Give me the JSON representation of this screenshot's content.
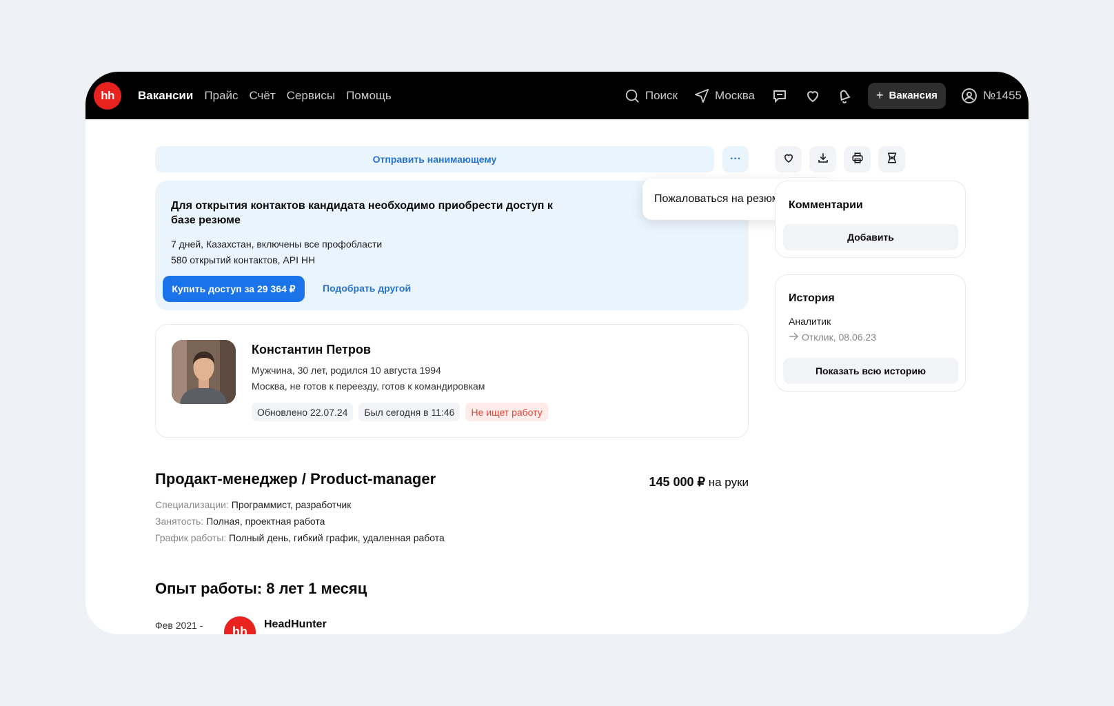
{
  "navbar": {
    "logo": "hh",
    "links": [
      "Вакансии",
      "Прайс",
      "Счёт",
      "Сервисы",
      "Помощь"
    ],
    "search_label": "Поиск",
    "city_label": "Москва",
    "vacancy_button": "Вакансия",
    "account_label": "№1455"
  },
  "actions": {
    "send_label": "Отправить нанимающему",
    "more_label": "···",
    "report_label": "Пожаловаться на резюме"
  },
  "access": {
    "title": "Для открытия контактов кандидата необходимо приобрести доступ к базе резюме",
    "line1": "7 дней, Казахстан, включены все профобласти",
    "line2": "580 открытий контактов, API HH",
    "buy_label": "Купить доступ за 29 364 ₽",
    "pick_label": "Подобрать другой"
  },
  "profile": {
    "name": "Константин Петров",
    "line1": "Мужчина, 30 лет, родился 10 августа 1994",
    "line2": "Москва, не готов к переезду, готов к командировкам",
    "tags": [
      "Обновлено 22.07.24",
      "Был сегодня в 11:46",
      "Не ищет работу"
    ]
  },
  "resume": {
    "title": "Продакт-менеджер / Product-manager",
    "salary_amount": "145 000 ₽",
    "salary_suffix": "на руки",
    "spec_label": "Специализации:",
    "spec_value": "Программист, разработчик",
    "employment_label": "Занятость:",
    "employment_value": "Полная, проектная работа",
    "schedule_label": "График работы:",
    "schedule_value": "Полный день, гибкий график, удаленная работа",
    "experience_title": "Опыт работы: 8 лет 1 месяц",
    "exp_date": "Фев 2021 -",
    "exp_logo": "hh",
    "exp_company": "HeadHunter"
  },
  "sidebar": {
    "comments_title": "Комментарии",
    "add_label": "Добавить",
    "history_title": "История",
    "history_role": "Аналитик",
    "history_response": "Отклик, 08.06.23",
    "show_history_label": "Показать всю историю"
  },
  "colors": {
    "brand_red": "#e8231f",
    "primary_blue": "#1a73e8",
    "link_blue": "#2874d0",
    "light_blue_bg": "#eaf4fc",
    "status_red": "#e0473a"
  }
}
